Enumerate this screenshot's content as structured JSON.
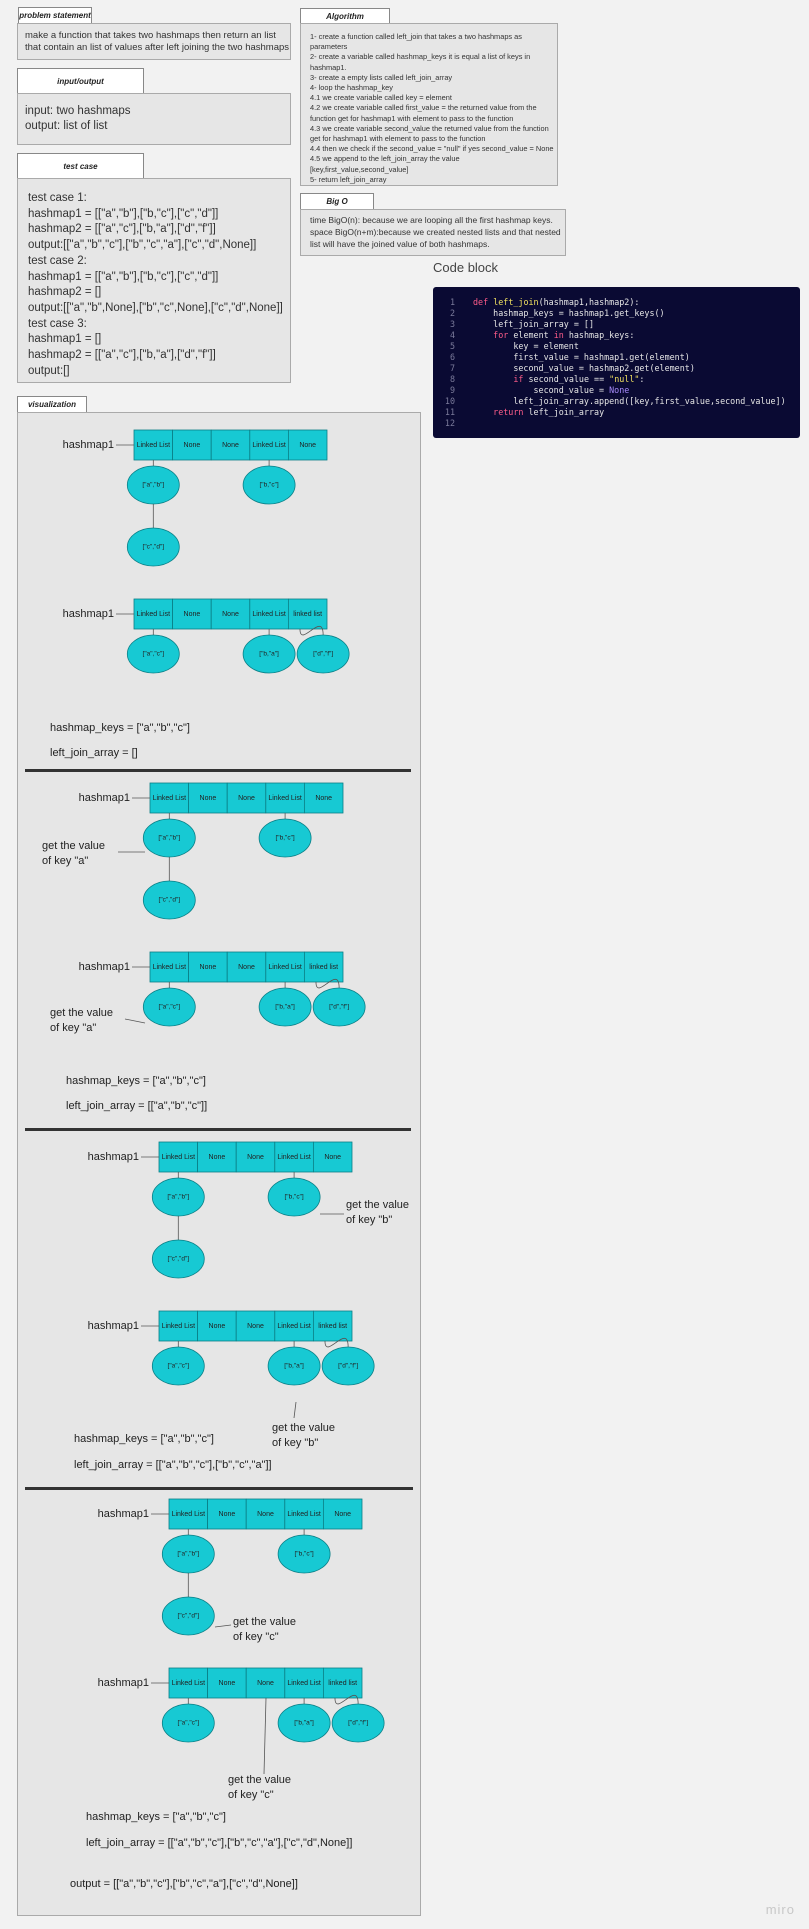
{
  "problem": {
    "tab": "problem statement",
    "text": [
      "make a function that takes two hashmaps then return an list",
      "that contain an list of values after left joining the two hashmaps"
    ]
  },
  "io": {
    "tab": "input/output",
    "input": "input: two hashmaps",
    "output": "output: list of list"
  },
  "testcase": {
    "tab": "test case",
    "lines": [
      "test case 1:",
      "hashmap1 = [[\"a\",\"b\"],[\"b,\"c\"],[\"c\",\"d\"]]",
      "hashmap2 = [[\"a\",\"c\"],[\"b,\"a\"],[\"d\",\"f\"]]",
      "output:[[\"a\",\"b\",\"c\"],[\"b\",\"c\",\"a\"],[\"c\",\"d\",None]]",
      "test case 2:",
      "hashmap1 = [[\"a\",\"b\"],[\"b,\"c\"],[\"c\",\"d\"]]",
      "hashmap2 = []",
      "output:[[\"a\",\"b\",None],[\"b\",\"c\",None],[\"c\",\"d\",None]]",
      "test case 3:",
      "hashmap1 = []",
      "hashmap2 = [[\"a\",\"c\"],[\"b,\"a\"],[\"d\",\"f\"]]",
      "output:[]"
    ]
  },
  "algorithm": {
    "tab": "Algorithm",
    "lines": [
      "1- create a function called left_join that takes a two hashmaps as",
      "parameters",
      "2- create a variable called hashmap_keys it is equal a list of keys in",
      "hashmap1.",
      "3- create a empty lists called left_join_array",
      "4- loop the hashmap_key",
      "4.1 we create variable called key = element",
      "4.2 we create variable called first_value = the returned value from the",
      "function get for hashmap1 with element to pass to the function",
      "4.3 we create variable second_value the returned value from the function",
      "get for hashmap1 with element to pass to the function",
      "4.4 then we check if the second_value = \"null\" if yes second_value = None",
      "4.5 we append to the left_join_array the value",
      "[key,first_value,second_value]",
      "5- return left_join_array"
    ]
  },
  "bigo": {
    "tab": "Big O",
    "lines": [
      "time BigO(n): because we are looping all the first hashmap keys.",
      "space BigO(n+m):because we created nested lists and that nested",
      "list will have the joined value of both hashmaps."
    ]
  },
  "code_block": {
    "title": "Code block",
    "line_numbers": [
      "1",
      "2",
      "3",
      "4",
      "5",
      "6",
      "7",
      "8",
      "9",
      "10",
      "11",
      "12"
    ]
  },
  "visualization": {
    "tab": "visualization",
    "node_labels": {
      "linked": "Linked List",
      "none": "None",
      "linked_lower": "linked list"
    },
    "bubbles": {
      "ab": "[\"a\",\"b\"]",
      "bc": "[\"b,\"c\"]",
      "cd": "[\"c\",\"d\"]",
      "ac": "[\"a\",\"c\"]",
      "ba": "[\"b,\"a\"]",
      "df": "[\"d\",\"f\"]"
    },
    "hashmap_label": "hashmap1",
    "get_a": [
      "get the value",
      "of key \"a\""
    ],
    "get_b": [
      "get the value",
      "of key \"b\""
    ],
    "get_c": [
      "get the value",
      "of key \"c\""
    ],
    "keys": "hashmap_keys = [\"a\",\"b\",\"c\"]",
    "lj0": "left_join_array = []",
    "lj1": "left_join_array = [[\"a\",\"b\",\"c\"]]",
    "lj2": "left_join_array = [[\"a\",\"b\",\"c\"],[\"b\",\"c\",\"a\"]]",
    "lj3": "left_join_array = [[\"a\",\"b\",\"c\"],[\"b\",\"c\",\"a\"],[\"c\",\"d\",None]]",
    "output": "output = [[\"a\",\"b\",\"c\"],[\"b\",\"c\",\"a\"],[\"c\",\"d\",None]]"
  },
  "watermark": "miro",
  "colors": {
    "node": "#17c9d3",
    "bubble": "#17c9d3",
    "code_bg": "#0a0a33"
  }
}
